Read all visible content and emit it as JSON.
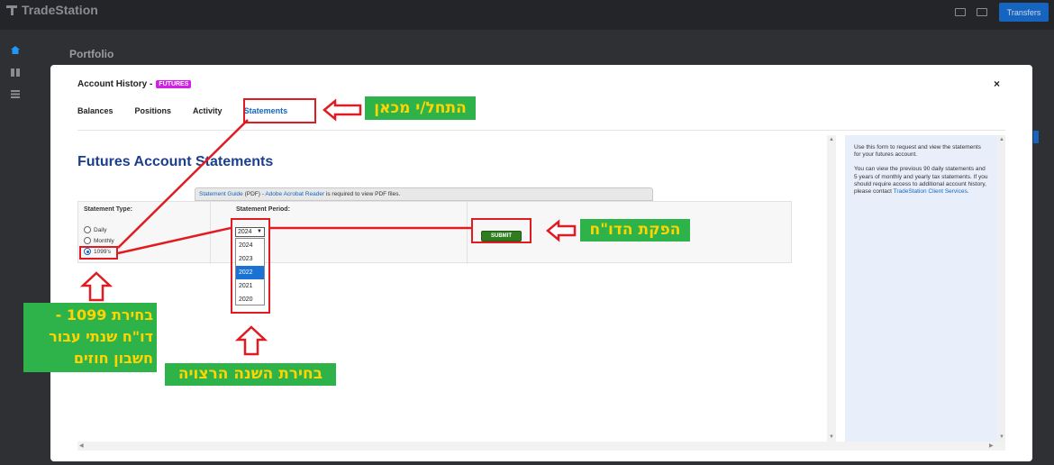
{
  "brand": {
    "name": "TradeStation"
  },
  "header": {
    "transfers_label": "Transfers",
    "icons": [
      "mail-icon",
      "chat-icon"
    ]
  },
  "leftrail": {
    "icons": [
      "home-icon",
      "dashboard-icon",
      "list-icon"
    ]
  },
  "page": {
    "title": "Portfolio"
  },
  "modal": {
    "title": "Account History -",
    "badge": "FUTURES",
    "close": "×",
    "tabs": [
      {
        "label": "Balances"
      },
      {
        "label": "Positions"
      },
      {
        "label": "Activity"
      },
      {
        "label": "Statements"
      }
    ],
    "active_tab": "Statements"
  },
  "statements": {
    "heading": "Futures Account Statements",
    "guide_link": "Statement Guide",
    "guide_mid": " (PDF) - ",
    "reader_link": "Adobe Acrobat Reader",
    "guide_tail": " is required to view PDF files.",
    "type_label": "Statement Type:",
    "types": [
      "Daily",
      "Monthly",
      "1099's"
    ],
    "selected_type": "1099's",
    "period_label": "Statement Period:",
    "period_value": "2024",
    "years": [
      "2024",
      "2023",
      "2022",
      "2021",
      "2020"
    ],
    "highlighted_year": "2022",
    "submit_label": "SUBMIT"
  },
  "info": {
    "p1": "Use this form to request and view the statements for your futures account.",
    "p2": "You can view the previous 90 daily statements and 5 years of monthly and yearly tax statements. If you should require access to additional account history, please contact ",
    "p2_link": "TradeStation Client Services",
    "p2_end": "."
  },
  "annotations": {
    "start_here": "התחל/י מכאן",
    "produce_report": "הפקת הדו\"ח",
    "choose_1099_line1": "בחירת 1099 -",
    "choose_1099_line2": "דו\"ח שנתי עבור",
    "choose_1099_line3": "חשבון חוזים",
    "choose_year": "בחירת השנה הרצויה"
  },
  "colors": {
    "annotation_red": "#e11b22",
    "annotation_green": "#2db34a",
    "annotation_text": "#ffd400",
    "accent": "#1565c0",
    "badge": "#d21ee8",
    "submit": "#2f7d1f"
  }
}
